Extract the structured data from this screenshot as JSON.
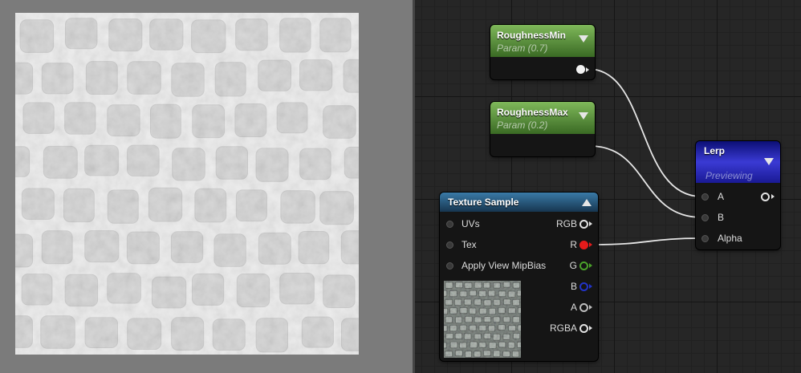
{
  "nodes": {
    "roughness_min": {
      "title": "RoughnessMin",
      "subtitle": "Param (0.7)"
    },
    "roughness_max": {
      "title": "RoughnessMax",
      "subtitle": "Param (0.2)"
    },
    "lerp": {
      "title": "Lerp",
      "subtitle": "Previewing",
      "inputs": [
        "A",
        "B",
        "Alpha"
      ]
    },
    "texture_sample": {
      "title": "Texture Sample",
      "inputs": [
        "UVs",
        "Tex",
        "Apply View MipBias"
      ],
      "outputs": [
        "RGB",
        "R",
        "G",
        "B",
        "A",
        "RGBA"
      ]
    }
  },
  "colors": {
    "pin_r": "#e51b1b",
    "pin_g": "#4aa12a",
    "pin_b": "#2233c8",
    "wire": "#e6e6e6",
    "graph_bg": "#262626",
    "preview_bg": "#7b7b7b"
  }
}
